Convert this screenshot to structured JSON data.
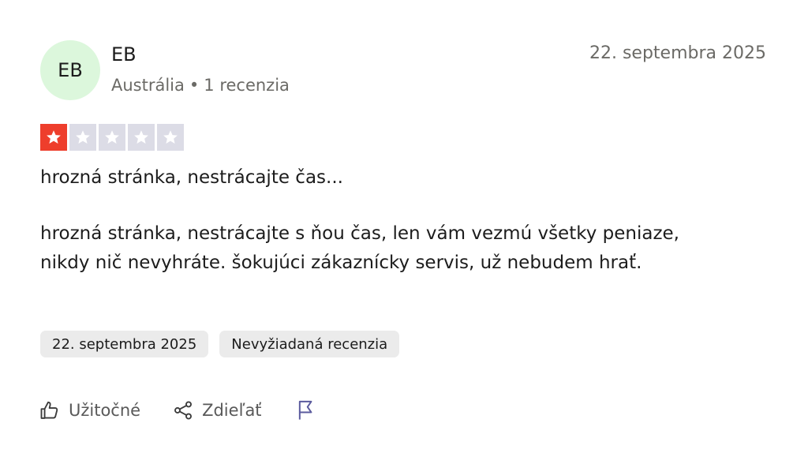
{
  "reviewer": {
    "initials": "EB",
    "name": "EB",
    "country": "Austrália",
    "separator": "•",
    "review_count": "1 recenzia"
  },
  "review": {
    "date": "22. septembra 2025",
    "rating": 1,
    "rating_max": 5,
    "title": "hrozná stránka, nestrácajte čas...",
    "body": "hrozná stránka, nestrácajte s ňou čas, len vám vezmú všetky peniaze, nikdy nič nevyhráte. šokujúci zákaznícky servis, už nebudem hrať.",
    "tags": [
      "22. septembra 2025",
      "Nevyžiadaná recenzia"
    ]
  },
  "actions": {
    "useful_label": "Užitočné",
    "share_label": "Zdieľať",
    "useful_icon": "thumbs-up-icon",
    "share_icon": "share-icon",
    "report_icon": "flag-icon"
  },
  "colors": {
    "avatar_bg": "#dcf7dc",
    "star_filled": "#ee3e2c",
    "star_empty": "#dcdce6",
    "tag_bg": "#ebebeb",
    "flag_icon": "#5b5b9e"
  }
}
